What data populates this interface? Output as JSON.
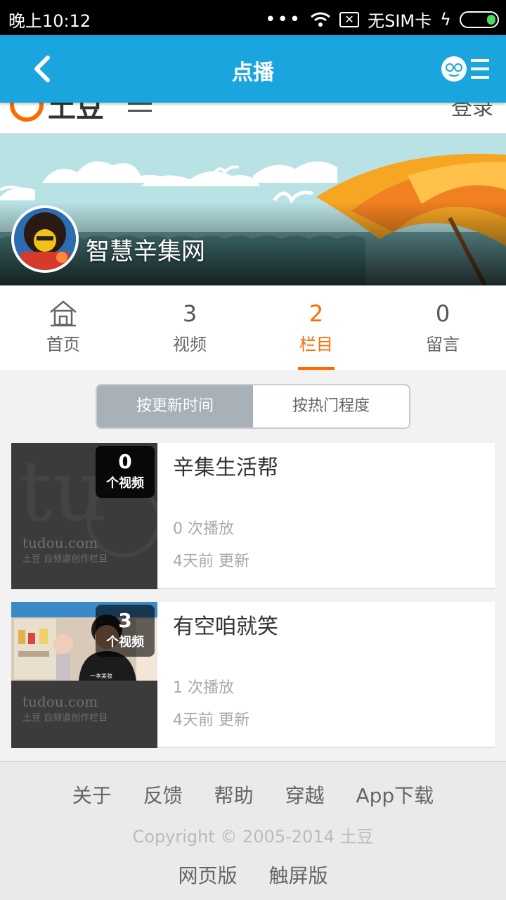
{
  "status_bar": {
    "time": "晚上10:12",
    "dots": "•••",
    "sim_icon_text": "✕",
    "sim_status": "无SIM卡",
    "charging_symbol": "ϟ"
  },
  "nav": {
    "title": "点播",
    "back_icon": "chevron-left-icon",
    "menu_icon": "profile-menu-icon"
  },
  "site_header": {
    "logo_text": "土豆",
    "login_label": "登录"
  },
  "channel": {
    "name": "智慧辛集网"
  },
  "tabs": [
    {
      "count": "",
      "label": "首页",
      "icon": "home-icon",
      "active": false
    },
    {
      "count": "3",
      "label": "视频",
      "active": false
    },
    {
      "count": "2",
      "label": "栏目",
      "active": true
    },
    {
      "count": "0",
      "label": "留言",
      "active": false
    }
  ],
  "sort": {
    "by_update": "按更新时间",
    "by_popularity": "按热门程度",
    "selected": "按更新时间"
  },
  "playlists": [
    {
      "title": "辛集生活帮",
      "video_count": "0",
      "video_unit": "个视频",
      "plays": "0 次播放",
      "updated": "4天前 更新",
      "watermark_brand": "tudou.com",
      "watermark_caption": "土豆 自频道创作栏目"
    },
    {
      "title": "有空咱就笑",
      "video_count": "3",
      "video_unit": "个视频",
      "plays": "1 次播放",
      "updated": "4天前 更新",
      "watermark_brand": "tudou.com",
      "watermark_caption": "土豆 自频道创作栏目"
    }
  ],
  "footer": {
    "links": [
      "关于",
      "反馈",
      "帮助",
      "穿越",
      "App下载"
    ],
    "copyright": "Copyright © 2005-2014 土豆",
    "versions": [
      "网页版",
      "触屏版"
    ]
  },
  "colors": {
    "nav_bar": "#1aa5de",
    "accent": "#ff6a00",
    "sort_active": "#a8b1b8"
  }
}
